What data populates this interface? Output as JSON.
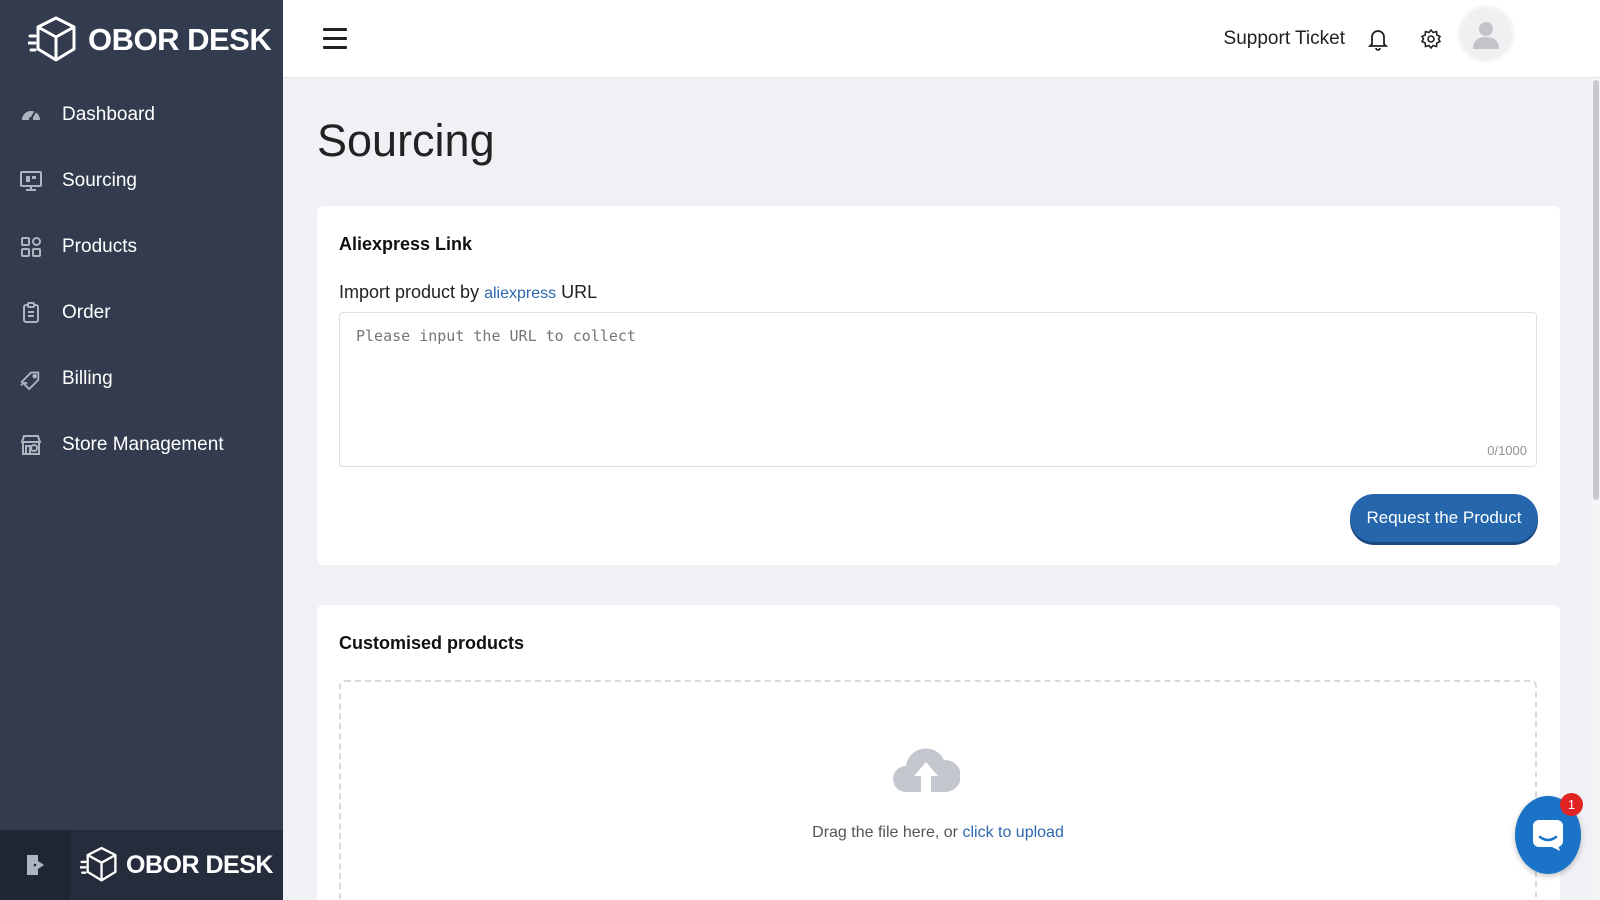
{
  "brand": {
    "name": "OBOR DESK"
  },
  "sidebar": {
    "items": [
      {
        "label": "Dashboard",
        "icon": "dashboard-icon"
      },
      {
        "label": "Sourcing",
        "icon": "sourcing-icon"
      },
      {
        "label": "Products",
        "icon": "products-icon"
      },
      {
        "label": "Order",
        "icon": "order-icon"
      },
      {
        "label": "Billing",
        "icon": "billing-icon"
      },
      {
        "label": "Store Management",
        "icon": "store-icon"
      }
    ],
    "footer_logo": "OBOR DESK"
  },
  "header": {
    "support_label": "Support Ticket"
  },
  "main": {
    "title": "Sourcing",
    "aliexpress_card": {
      "title": "Aliexpress Link",
      "label_prefix": "Import product by",
      "label_link": "aliexpress",
      "label_suffix": "URL",
      "placeholder": "Please input the URL to collect",
      "counter": "0/1000",
      "button_label": "Request the Product"
    },
    "custom_card": {
      "title": "Customised products",
      "upload_prefix": "Drag the file here, or",
      "upload_link": "click to upload"
    }
  },
  "chat": {
    "badge": "1"
  },
  "colors": {
    "sidebar": "#323c4e",
    "accent": "#2566ad",
    "badge": "#e02424"
  }
}
